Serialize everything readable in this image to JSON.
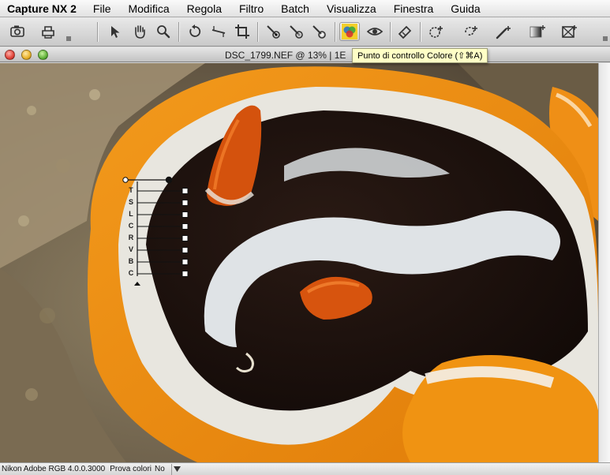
{
  "menubar": {
    "app_name": "Capture NX 2",
    "items": [
      "File",
      "Modifica",
      "Regola",
      "Filtro",
      "Batch",
      "Visualizza",
      "Finestra",
      "Guida"
    ]
  },
  "toolbar": {
    "tools": [
      "camera-icon",
      "print-icon",
      "arrow-icon",
      "hand-icon",
      "zoom-icon",
      "rotate-icon",
      "straighten-icon",
      "crop-icon",
      "black-point-icon",
      "neutral-point-icon",
      "white-point-icon",
      "color-control-point-icon",
      "red-eye-icon",
      "auto-retouch-icon",
      "selection-control-point-icon",
      "lasso-icon",
      "brush-icon",
      "gradient-icon",
      "fill-icon"
    ]
  },
  "window": {
    "title": "DSC_1799.NEF @ 13% | 1Ε"
  },
  "tooltip": {
    "text": "Punto di controllo Colore (⇧⌘A)"
  },
  "control_point": {
    "sliders": [
      "T",
      "S",
      "L",
      "C",
      "R",
      "V",
      "B",
      "C"
    ]
  },
  "statusbar": {
    "profile": "Nikon Adobe RGB 4.0.0.3000",
    "proof_label": "Prova colori",
    "proof_value": "No"
  },
  "colors": {
    "accent_orange": "#f08a10",
    "nudibranch_black": "#1a0f0c",
    "stripe_white": "#e9ecee"
  }
}
